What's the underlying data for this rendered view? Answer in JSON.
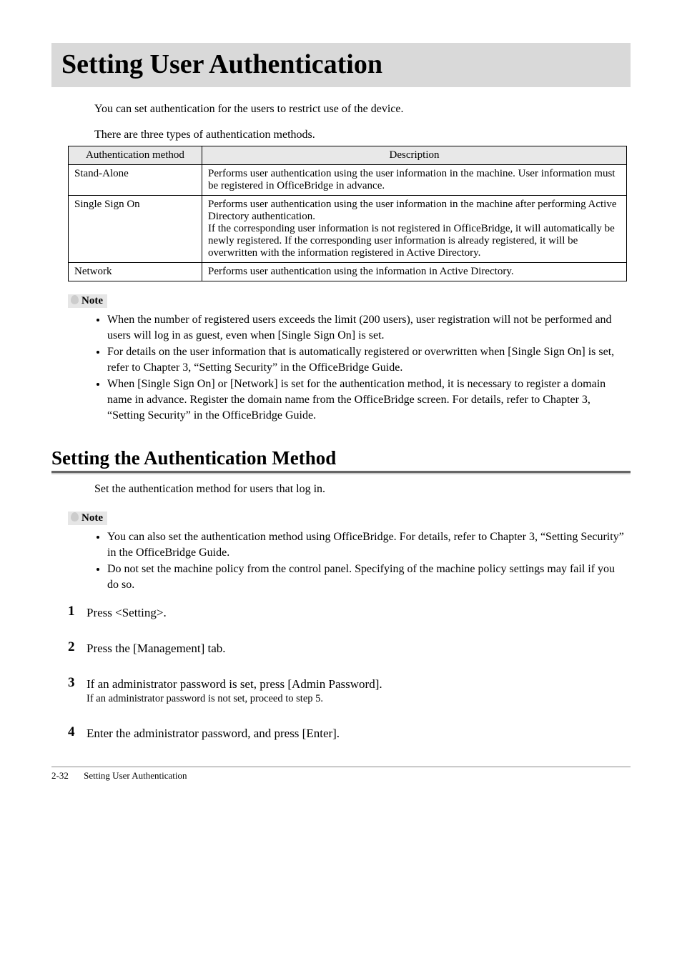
{
  "title": "Setting User Authentication",
  "intro1": "You can set authentication for the users to restrict use of the device.",
  "intro2": "There are three types of authentication methods.",
  "table": {
    "headers": {
      "method": "Authentication method",
      "desc": "Description"
    },
    "rows": [
      {
        "method": "Stand-Alone",
        "desc": "Performs user authentication using the user information in the machine. User information must be registered in OfficeBridge in advance."
      },
      {
        "method": "Single Sign On",
        "desc": "Performs user authentication using the user information in the machine after performing Active Directory authentication.\nIf the corresponding user information is not registered in OfficeBridge, it will automatically be newly registered. If the corresponding user information is already registered, it will be overwritten with the information registered in Active Directory."
      },
      {
        "method": "Network",
        "desc": "Performs user authentication using the information in Active Directory."
      }
    ]
  },
  "noteLabel": "Note",
  "notes1": [
    "When the number of registered users exceeds the limit (200 users), user registration will not be performed and users will log in as guest, even when [Single Sign On] is set.",
    "For details on the user information that is automatically registered or overwritten when [Single Sign On] is set, refer to Chapter 3, “Setting Security” in the OfficeBridge Guide.",
    "When [Single Sign On] or [Network] is set for the authentication method, it is necessary to register a domain name in advance. Register the domain name from the OfficeBridge screen. For details, refer to Chapter 3, “Setting Security” in the OfficeBridge Guide."
  ],
  "sectionHeading": "Setting the Authentication Method",
  "sectionLead": "Set the authentication method for users that log in.",
  "notes2": [
    "You can also set the authentication method using OfficeBridge. For details, refer to Chapter 3, “Setting Security” in the OfficeBridge Guide.",
    "Do not set the machine policy from the control panel. Specifying of the machine policy settings may fail if you do so."
  ],
  "steps": [
    {
      "num": "1",
      "body": "Press <Setting>.",
      "note": ""
    },
    {
      "num": "2",
      "body": "Press the [Management] tab.",
      "note": ""
    },
    {
      "num": "3",
      "body": "If an administrator password is set, press [Admin Password].",
      "note": "If an administrator password is not set, proceed to step 5."
    },
    {
      "num": "4",
      "body": "Enter the administrator password, and press [Enter].",
      "note": ""
    }
  ],
  "footer": {
    "pagenum": "2-32",
    "title": "Setting User Authentication"
  }
}
